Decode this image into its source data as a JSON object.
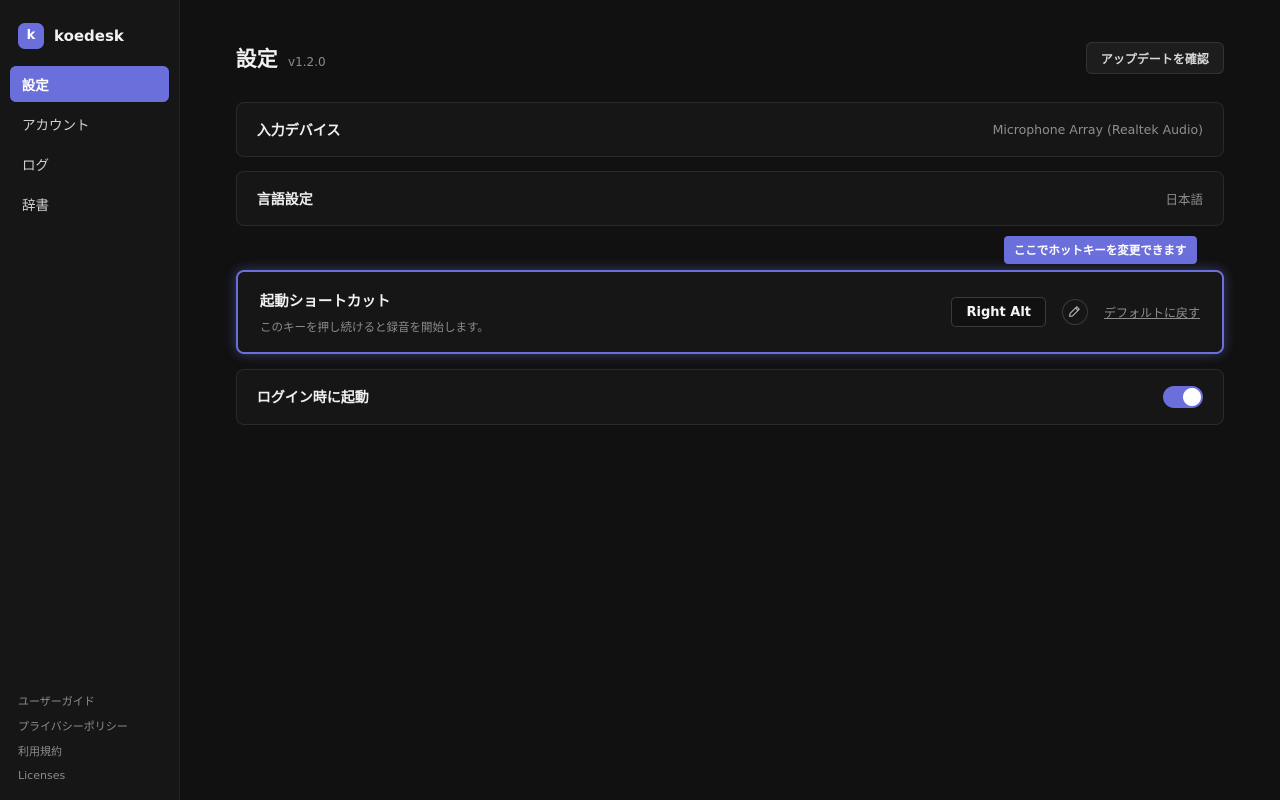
{
  "brand": {
    "logo_letter": "k",
    "name": "koedesk",
    "accent": "#6b6fdc"
  },
  "sidebar": {
    "items": [
      {
        "label": "設定",
        "active": true
      },
      {
        "label": "アカウント",
        "active": false
      },
      {
        "label": "ログ",
        "active": false
      },
      {
        "label": "辞書",
        "active": false
      }
    ],
    "footer": [
      {
        "label": "ユーザーガイド"
      },
      {
        "label": "プライバシーポリシー"
      },
      {
        "label": "利用規約"
      },
      {
        "label": "Licenses"
      }
    ]
  },
  "header": {
    "title": "設定",
    "version": "v1.2.0",
    "update_button": "アップデートを確認"
  },
  "settings": {
    "input_device": {
      "label": "入力デバイス",
      "value": "Microphone Array (Realtek Audio)"
    },
    "language": {
      "label": "言語設定",
      "value": "日本語"
    },
    "shortcut": {
      "tooltip": "ここでホットキーを変更できます",
      "title": "起動ショートカット",
      "description": "このキーを押し続けると録音を開始します。",
      "key": "Right Alt",
      "edit_icon": "pencil-icon",
      "reset_label": "デフォルトに戻す"
    },
    "launch_at_login": {
      "label": "ログイン時に起動",
      "enabled": true
    }
  }
}
